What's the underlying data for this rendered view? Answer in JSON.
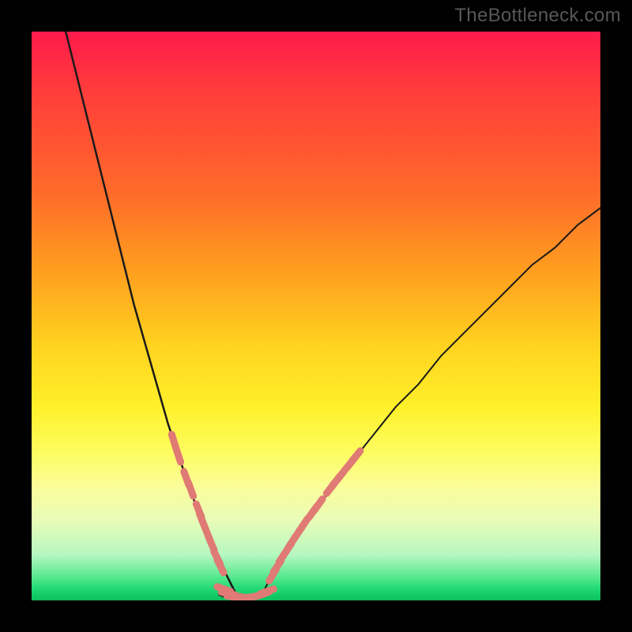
{
  "watermark": "TheBottleneck.com",
  "colors": {
    "background": "#000000",
    "curve": "#1a1a1a",
    "marker": "#e07a74",
    "gradient_top": "#ff1a4c",
    "gradient_bottom": "#0bbf5d"
  },
  "chart_data": {
    "type": "line",
    "title": "",
    "xlabel": "",
    "ylabel": "",
    "xlim": [
      0,
      100
    ],
    "ylim": [
      0,
      100
    ],
    "grid": false,
    "legend": false,
    "series": [
      {
        "name": "left-curve",
        "x": [
          6,
          8,
          10,
          12,
          14,
          16,
          18,
          20,
          22,
          24,
          26,
          28,
          30,
          32,
          33,
          34,
          35,
          36
        ],
        "y": [
          100,
          92,
          84,
          76,
          68,
          60,
          52,
          45,
          38,
          31,
          25,
          19,
          14,
          9,
          7,
          5,
          3,
          1
        ]
      },
      {
        "name": "right-curve",
        "x": [
          40,
          41,
          42,
          44,
          46,
          48,
          50,
          53,
          56,
          60,
          64,
          68,
          72,
          76,
          80,
          84,
          88,
          92,
          96,
          100
        ],
        "y": [
          1,
          2,
          4,
          7,
          10,
          13,
          16,
          20,
          24,
          29,
          34,
          38,
          43,
          47,
          51,
          55,
          59,
          62,
          66,
          69
        ]
      },
      {
        "name": "valley-floor",
        "x": [
          33,
          34,
          35,
          36,
          37,
          38,
          39,
          40,
          41,
          42
        ],
        "y": [
          1,
          0.6,
          0.3,
          0.2,
          0.2,
          0.2,
          0.3,
          0.5,
          0.8,
          1.2
        ]
      }
    ],
    "markers": [
      {
        "series": "left-curve",
        "x": 25.0,
        "y": 28.0
      },
      {
        "series": "left-curve",
        "x": 25.8,
        "y": 25.5
      },
      {
        "series": "left-curve",
        "x": 27.2,
        "y": 21.5
      },
      {
        "series": "left-curve",
        "x": 28.0,
        "y": 19.5
      },
      {
        "series": "left-curve",
        "x": 29.4,
        "y": 15.8
      },
      {
        "series": "left-curve",
        "x": 30.0,
        "y": 14.0
      },
      {
        "series": "left-curve",
        "x": 30.8,
        "y": 12.0
      },
      {
        "series": "left-curve",
        "x": 31.6,
        "y": 10.0
      },
      {
        "series": "left-curve",
        "x": 32.6,
        "y": 7.5
      },
      {
        "series": "left-curve",
        "x": 33.2,
        "y": 6.0
      },
      {
        "series": "valley-floor",
        "x": 33.8,
        "y": 2.0
      },
      {
        "series": "valley-floor",
        "x": 34.6,
        "y": 1.2
      },
      {
        "series": "valley-floor",
        "x": 35.6,
        "y": 0.7
      },
      {
        "series": "valley-floor",
        "x": 36.6,
        "y": 0.5
      },
      {
        "series": "valley-floor",
        "x": 37.6,
        "y": 0.5
      },
      {
        "series": "valley-floor",
        "x": 38.6,
        "y": 0.6
      },
      {
        "series": "valley-floor",
        "x": 39.6,
        "y": 0.8
      },
      {
        "series": "valley-floor",
        "x": 40.6,
        "y": 1.1
      },
      {
        "series": "valley-floor",
        "x": 41.4,
        "y": 1.6
      },
      {
        "series": "right-curve",
        "x": 42.4,
        "y": 4.5
      },
      {
        "series": "right-curve",
        "x": 43.2,
        "y": 6.0
      },
      {
        "series": "right-curve",
        "x": 44.2,
        "y": 7.8
      },
      {
        "series": "right-curve",
        "x": 45.0,
        "y": 9.0
      },
      {
        "series": "right-curve",
        "x": 45.8,
        "y": 10.3
      },
      {
        "series": "right-curve",
        "x": 46.8,
        "y": 11.8
      },
      {
        "series": "right-curve",
        "x": 47.8,
        "y": 13.3
      },
      {
        "series": "right-curve",
        "x": 49.4,
        "y": 15.5
      },
      {
        "series": "right-curve",
        "x": 50.4,
        "y": 16.8
      },
      {
        "series": "right-curve",
        "x": 52.6,
        "y": 19.8
      },
      {
        "series": "right-curve",
        "x": 53.4,
        "y": 20.8
      },
      {
        "series": "right-curve",
        "x": 54.6,
        "y": 22.3
      },
      {
        "series": "right-curve",
        "x": 56.2,
        "y": 24.3
      },
      {
        "series": "right-curve",
        "x": 57.0,
        "y": 25.3
      }
    ]
  }
}
